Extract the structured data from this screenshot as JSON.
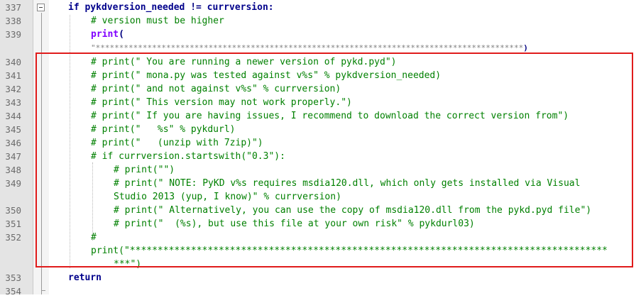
{
  "gutter": {
    "line_numbers": [
      "337",
      "338",
      "339",
      "340",
      "341",
      "342",
      "343",
      "344",
      "345",
      "346",
      "347",
      "348",
      "349",
      "350",
      "351",
      "352",
      "353",
      "354"
    ]
  },
  "code": {
    "l337_kw": "if",
    "l337_rest": " pykdversion_needed ",
    "l337_op": "!=",
    "l337_end": " currversion:",
    "l338": "# version must be higher",
    "l339_fn": "print",
    "l339_paren": "(",
    "l339b_str": "\"*******************************************************************************************",
    "l339b_paren": ")",
    "l340": "# print(\" You are running a newer version of pykd.pyd\")",
    "l341": "# print(\" mona.py was tested against v%s\" % pykdversion_needed)",
    "l342": "# print(\" and not against v%s\" % currversion)",
    "l343": "# print(\" This version may not work properly.\")",
    "l344": "# print(\" If you are having issues, I recommend to download the correct version from\")",
    "l345": "# print(\"   %s\" % pykdurl)",
    "l346": "# print(\"   (unzip with 7zip)\")",
    "l347": "# if currversion.startswith(\"0.3\"):",
    "l348": "# print(\"\")",
    "l349": "# print(\" NOTE: PyKD v%s requires msdia120.dll, which only gets installed via Visual",
    "l349b": "Studio 2013 (yup, I know)\" % currversion)",
    "l350": "# print(\" Alternatively, you can use the copy of msdia120.dll from the pykd.pyd file\")",
    "l351": "# print(\"  (%s), but use this file at your own risk\" % pykdurl03)",
    "l352": "#",
    "l352b": "print(\"**************************************************************************************",
    "l352c": "***\")",
    "l353": "return"
  },
  "colors": {
    "keyword": "#00008b",
    "function": "#8000ff",
    "comment": "#008000",
    "string": "#808080",
    "highlight_border": "#e01b1b"
  }
}
